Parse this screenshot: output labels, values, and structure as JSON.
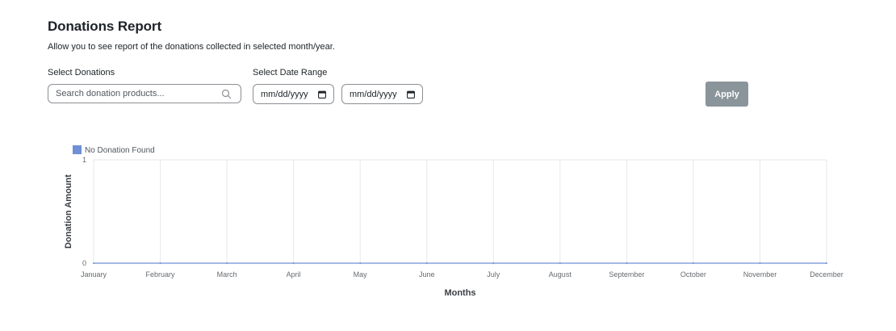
{
  "header": {
    "title": "Donations Report",
    "subtitle": "Allow you to see report of the donations collected in selected month/year."
  },
  "filters": {
    "donations_label": "Select Donations",
    "search_placeholder": "Search donation products...",
    "date_range_label": "Select Date Range",
    "date_start": "mm/dd/yyyy",
    "date_end": "mm/dd/yyyy",
    "apply_label": "Apply"
  },
  "colors": {
    "series": "#6f8fd6",
    "apply_button": "#8a949b",
    "grid": "#e6e8ea"
  },
  "icons": {
    "search": "search-icon",
    "calendar": "calendar-icon"
  },
  "chart_data": {
    "type": "line",
    "title": "",
    "xlabel": "Months",
    "ylabel": "Donation Amount",
    "categories": [
      "January",
      "February",
      "March",
      "April",
      "May",
      "June",
      "July",
      "August",
      "September",
      "October",
      "November",
      "December"
    ],
    "series": [
      {
        "name": "No Donation Found",
        "values": [
          0,
          0,
          0,
          0,
          0,
          0,
          0,
          0,
          0,
          0,
          0,
          0
        ]
      }
    ],
    "ylim": [
      0,
      1
    ],
    "yticks": [
      "0",
      "1"
    ],
    "grid": true,
    "legend": "top-left"
  }
}
